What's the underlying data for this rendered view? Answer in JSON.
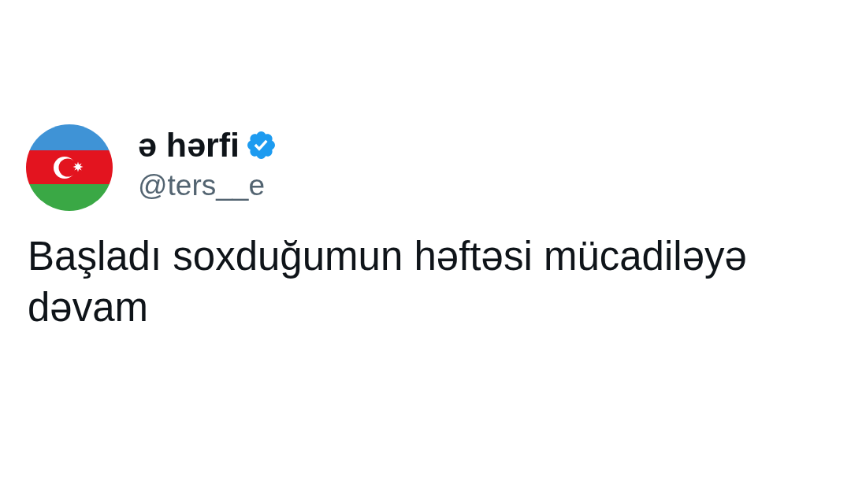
{
  "author": {
    "name": "ə hərfi",
    "verified": true,
    "handle": "@ters__e"
  },
  "tweet": {
    "text": "Başladı soxduğumun həftəsi mücadiləyə dəvam"
  }
}
